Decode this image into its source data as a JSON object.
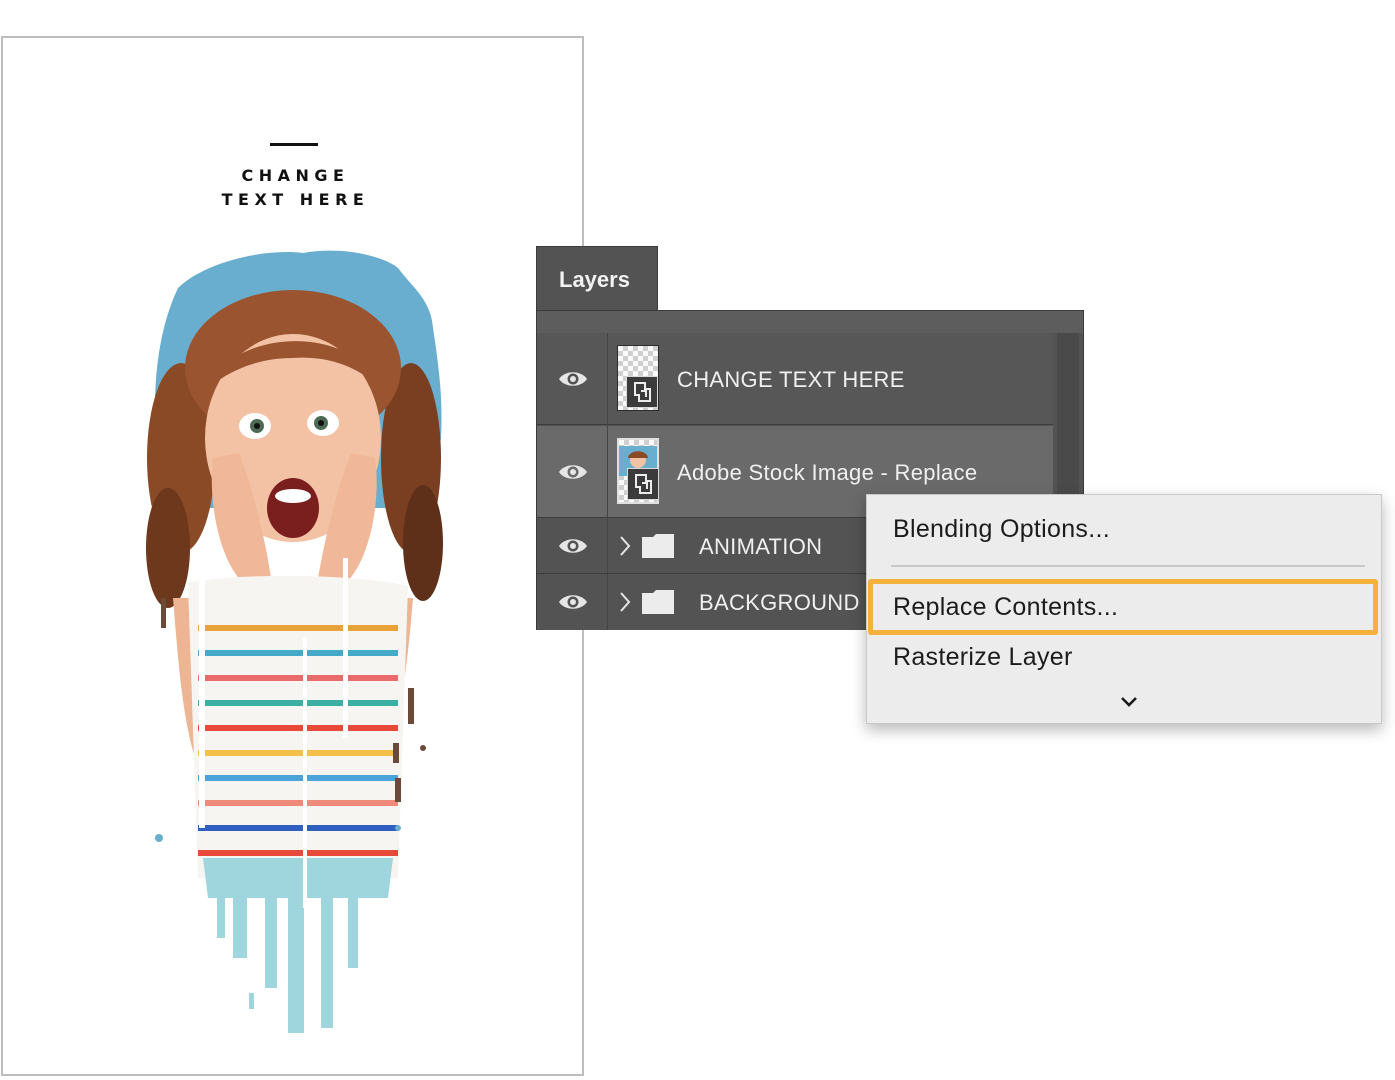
{
  "artboard": {
    "headline_line1": "CHANGE",
    "headline_line2": "TEXT HERE"
  },
  "layers_panel": {
    "tab_label": "Layers",
    "layers": [
      {
        "name": "CHANGE TEXT HERE",
        "visible": true,
        "type": "smart-object",
        "thumb": "transparent"
      },
      {
        "name": "Adobe Stock Image - Replace",
        "visible": true,
        "type": "smart-object",
        "thumb": "photo",
        "selected": true
      },
      {
        "name": "ANIMATION",
        "visible": true,
        "type": "group",
        "collapsed": true
      },
      {
        "name": "BACKGROUND",
        "visible": true,
        "type": "group",
        "collapsed": true
      }
    ]
  },
  "context_menu": {
    "items": [
      {
        "label": "Blending Options..."
      },
      {
        "label": "Replace Contents...",
        "highlighted": true
      },
      {
        "label": "Rasterize Layer"
      }
    ],
    "more_icon": "chevron-down-icon"
  },
  "colors": {
    "panel_bg": "#535353",
    "selected_row": "#6a6a6a",
    "menu_bg": "#ececec",
    "highlight_outline": "#f4b13c",
    "photo_bg_blue": "#6aaecf"
  }
}
